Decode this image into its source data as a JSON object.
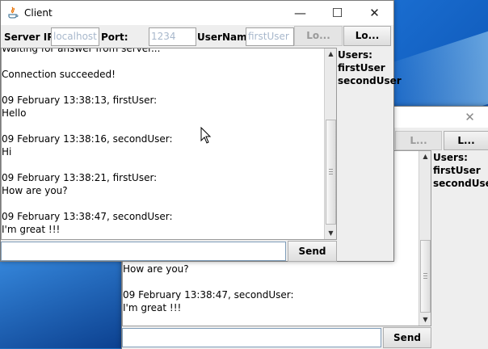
{
  "desktop": {
    "wallpaper_color": "#1b6fd2"
  },
  "back_window": {
    "buttons": {
      "login_label": "L...",
      "logout_label": "L..."
    },
    "chat_lines": [
      "How are you?",
      "",
      "09 February 13:38:47, secondUser:",
      "I'm great !!!"
    ],
    "users_title": "Users:",
    "users": [
      "firstUser",
      "secondUser"
    ],
    "message_value": "",
    "send_label": "Send"
  },
  "front_window": {
    "title": "Client",
    "server_ip_label": "Server IP:",
    "server_ip_placeholder": "localhost",
    "port_label": "Port:",
    "port_placeholder": "1234",
    "username_label": "UserName",
    "username_placeholder": "firstUser",
    "login_label": "Lo...",
    "logout_label": "Lo...",
    "chat_lines": [
      "Waiting for answer from server...",
      "",
      "Connection succeeded!",
      "",
      "09 February 13:38:13, firstUser:",
      "Hello",
      "",
      "09 February 13:38:16, secondUser:",
      "Hi",
      "",
      "09 February 13:38:21, firstUser:",
      "How are you?",
      "",
      "09 February 13:38:47, secondUser:",
      "I'm great !!!"
    ],
    "users_title": "Users:",
    "users": [
      "firstUser",
      "secondUser"
    ],
    "message_value": "",
    "send_label": "Send"
  }
}
